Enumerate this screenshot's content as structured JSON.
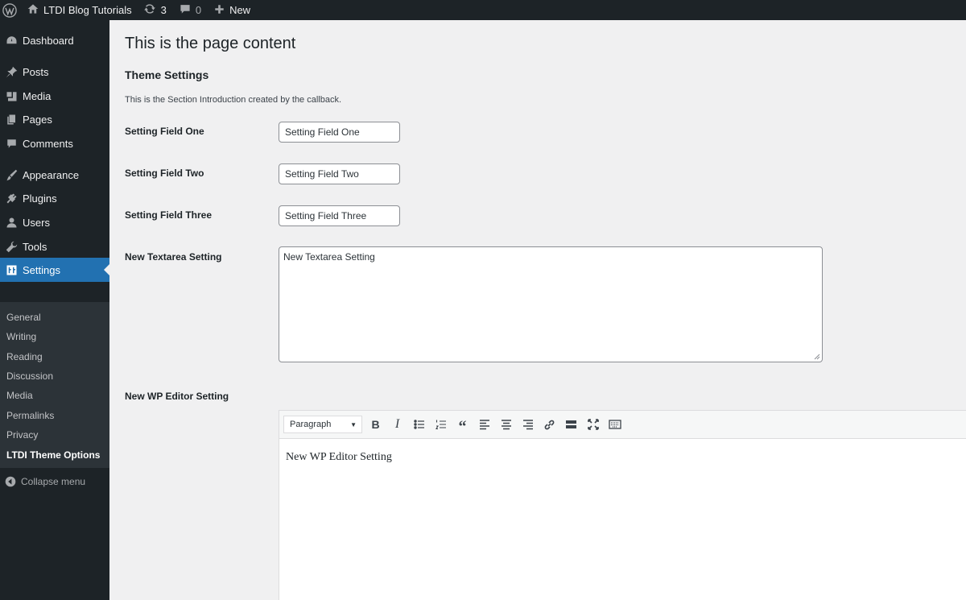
{
  "admin_bar": {
    "site_name": "LTDI Blog Tutorials",
    "updates_count": "3",
    "comments_count": "0",
    "new_label": "New"
  },
  "sidebar": {
    "items": [
      {
        "label": "Dashboard",
        "icon": "dashboard-icon"
      },
      {
        "label": "Posts",
        "icon": "pushpin-icon"
      },
      {
        "label": "Media",
        "icon": "media-icon"
      },
      {
        "label": "Pages",
        "icon": "pages-icon"
      },
      {
        "label": "Comments",
        "icon": "comment-icon"
      },
      {
        "label": "Appearance",
        "icon": "paintbrush-icon"
      },
      {
        "label": "Plugins",
        "icon": "plug-icon"
      },
      {
        "label": "Users",
        "icon": "user-icon"
      },
      {
        "label": "Tools",
        "icon": "wrench-icon"
      },
      {
        "label": "Settings",
        "icon": "settings-icon"
      }
    ],
    "submenu": [
      "General",
      "Writing",
      "Reading",
      "Discussion",
      "Media",
      "Permalinks",
      "Privacy",
      "LTDI Theme Options"
    ],
    "collapse_label": "Collapse menu"
  },
  "main": {
    "page_title": "This is the page content",
    "section_title": "Theme Settings",
    "section_intro": "This is the Section Introduction created by the callback.",
    "fields": [
      {
        "label": "Setting Field One",
        "value": "Setting Field One"
      },
      {
        "label": "Setting Field Two",
        "value": "Setting Field Two"
      },
      {
        "label": "Setting Field Three",
        "value": "Setting Field Three"
      }
    ],
    "textarea": {
      "label": "New Textarea Setting",
      "value": "New Textarea Setting"
    },
    "editor": {
      "label": "New WP Editor Setting",
      "format": "Paragraph",
      "content": "New WP Editor Setting"
    }
  },
  "colors": {
    "accent": "#2271b1",
    "sidebar_bg": "#1d2327",
    "submenu_bg": "#2c3338"
  }
}
